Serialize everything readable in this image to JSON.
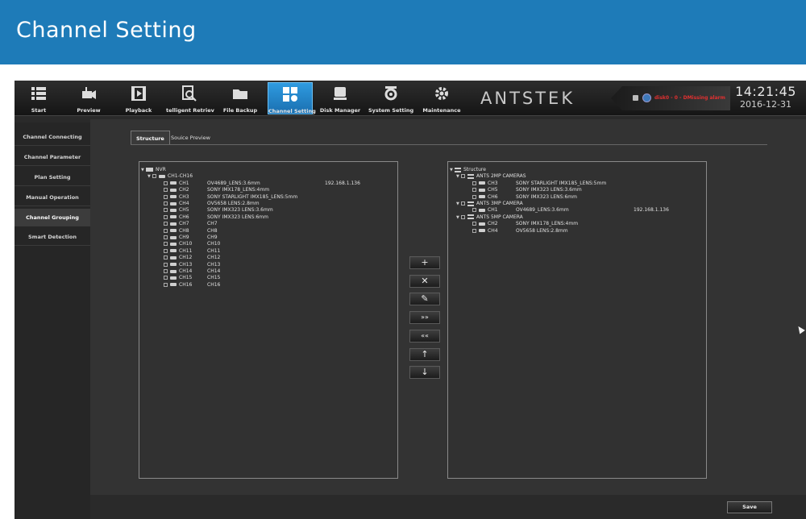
{
  "banner": {
    "title": "Channel Setting"
  },
  "toolbar": {
    "items": [
      {
        "label": "Start",
        "icon": "start-icon"
      },
      {
        "label": "Preview",
        "icon": "preview-icon"
      },
      {
        "label": "Playback",
        "icon": "playback-icon"
      },
      {
        "label": "telligent Retriev",
        "icon": "retrieval-icon"
      },
      {
        "label": "File Backup",
        "icon": "folder-icon"
      },
      {
        "label": "Channel Setting",
        "icon": "channel-setting-icon"
      },
      {
        "label": "Disk Manager",
        "icon": "disk-icon"
      },
      {
        "label": "System Setting",
        "icon": "system-setting-icon"
      },
      {
        "label": "Maintenance",
        "icon": "gear-icon"
      }
    ],
    "active_index": 5,
    "brand": "ANTSTEK",
    "alarm": "disk0 - 0 - DMissing alarm",
    "alarm_color": "#e03030",
    "time": "14:21:45",
    "date": "2016-12-31",
    "accent": "#1a8ad4"
  },
  "sidebar": {
    "items": [
      {
        "label": "Channel Connecting"
      },
      {
        "label": "Channel Parameter"
      },
      {
        "label": "Plan Setting"
      },
      {
        "label": "Manual Operation"
      },
      {
        "label": "Channel Grouping"
      },
      {
        "label": "Smart Detection"
      }
    ],
    "active_index": 4
  },
  "tabs": [
    {
      "label": "Structure"
    },
    {
      "label": "Souice Preview"
    }
  ],
  "left_tree": {
    "root": "NVR",
    "group": "CH1-CH16",
    "channels": [
      {
        "ch": "CH1",
        "model": "OV4689_LENS:3.6mm",
        "ip": "192.168.1.136"
      },
      {
        "ch": "CH2",
        "model": "SONY IMX178_LENS:4mm",
        "ip": ""
      },
      {
        "ch": "CH3",
        "model": "SONY STARLIGHT IMX185_LENS:5mm",
        "ip": ""
      },
      {
        "ch": "CH4",
        "model": "OV5658 LENS:2.8mm",
        "ip": ""
      },
      {
        "ch": "CH5",
        "model": "SONY IMX323 LENS:3.6mm",
        "ip": ""
      },
      {
        "ch": "CH6",
        "model": "SONY IMX323 LENS:6mm",
        "ip": ""
      },
      {
        "ch": "CH7",
        "model": "CH7",
        "ip": ""
      },
      {
        "ch": "CH8",
        "model": "CH8",
        "ip": ""
      },
      {
        "ch": "CH9",
        "model": "CH9",
        "ip": ""
      },
      {
        "ch": "CH10",
        "model": "CH10",
        "ip": ""
      },
      {
        "ch": "CH11",
        "model": "CH11",
        "ip": ""
      },
      {
        "ch": "CH12",
        "model": "CH12",
        "ip": ""
      },
      {
        "ch": "CH13",
        "model": "CH13",
        "ip": ""
      },
      {
        "ch": "CH14",
        "model": "CH14",
        "ip": ""
      },
      {
        "ch": "CH15",
        "model": "CH15",
        "ip": ""
      },
      {
        "ch": "CH16",
        "model": "CH16",
        "ip": ""
      }
    ]
  },
  "right_tree": {
    "root": "Structure",
    "groups": [
      {
        "name": "ANTS 2MP CAMERAS",
        "channels": [
          {
            "ch": "CH3",
            "model": "SONY STARLIGHT IMX185_LENS:5mm",
            "ip": ""
          },
          {
            "ch": "CH5",
            "model": "SONY IMX323 LENS:3.6mm",
            "ip": ""
          },
          {
            "ch": "CH6",
            "model": "SONY IMX323 LENS:6mm",
            "ip": ""
          }
        ]
      },
      {
        "name": "ANTS 3MP CAMERA",
        "channels": [
          {
            "ch": "CH1",
            "model": "OV4689_LENS:3.6mm",
            "ip": "192.168.1.136"
          }
        ]
      },
      {
        "name": "ANTS 5MP CAMERA",
        "channels": [
          {
            "ch": "CH2",
            "model": "SONY IMX178_LENS:4mm",
            "ip": ""
          },
          {
            "ch": "CH4",
            "model": "OV5658 LENS:2.8mm",
            "ip": ""
          }
        ]
      }
    ]
  },
  "ops": [
    {
      "name": "add-button",
      "glyph": "+"
    },
    {
      "name": "delete-button",
      "glyph": "✕"
    },
    {
      "name": "edit-button",
      "glyph": "✎"
    },
    {
      "name": "move-right-button",
      "glyph": "»»"
    },
    {
      "name": "move-left-button",
      "glyph": "««"
    },
    {
      "name": "move-up-button",
      "glyph": "↑"
    },
    {
      "name": "move-down-button",
      "glyph": "↓"
    }
  ],
  "footer": {
    "save_label": "Save"
  }
}
